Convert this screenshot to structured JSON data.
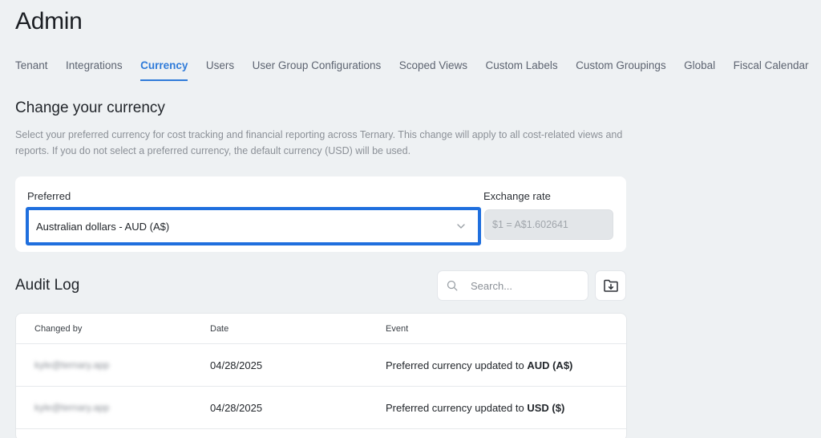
{
  "page": {
    "title": "Admin"
  },
  "tabs": [
    {
      "label": "Tenant",
      "active": false
    },
    {
      "label": "Integrations",
      "active": false
    },
    {
      "label": "Currency",
      "active": true
    },
    {
      "label": "Users",
      "active": false
    },
    {
      "label": "User Group Configurations",
      "active": false
    },
    {
      "label": "Scoped Views",
      "active": false
    },
    {
      "label": "Custom Labels",
      "active": false
    },
    {
      "label": "Custom Groupings",
      "active": false
    },
    {
      "label": "Global",
      "active": false
    },
    {
      "label": "Fiscal Calendar",
      "active": false
    }
  ],
  "currency": {
    "title": "Change your currency",
    "description": "Select your preferred currency for cost tracking and financial reporting across Ternary. This change will apply to all cost-related views and reports. If you do not select a preferred currency, the default currency (USD) will be used.",
    "preferred_label": "Preferred",
    "preferred_value": "Australian dollars - AUD (A$)",
    "rate_label": "Exchange rate",
    "rate_value": "$1 = A$1.602641"
  },
  "audit": {
    "title": "Audit Log",
    "search_placeholder": "Search...",
    "columns": {
      "changed_by": "Changed by",
      "date": "Date",
      "event": "Event"
    },
    "rows": [
      {
        "changed_by": "kyle@ternary.app",
        "date": "04/28/2025",
        "event_prefix": "Preferred currency updated to ",
        "event_value": "AUD (A$)"
      },
      {
        "changed_by": "kyle@ternary.app",
        "date": "04/28/2025",
        "event_prefix": "Preferred currency updated to ",
        "event_value": "USD ($)"
      }
    ]
  },
  "icons": {
    "search": "search-icon",
    "export": "folder-download-icon",
    "dropdown": "chevron-down-icon"
  },
  "colors": {
    "accent": "#2f7bd9",
    "focus_border": "#1f6fde"
  }
}
